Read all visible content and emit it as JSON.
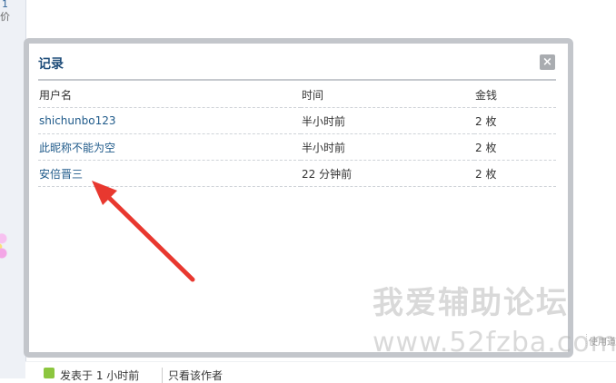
{
  "background": {
    "left_fragment_1": "1",
    "left_fragment_2": "价",
    "side_hint": "使用道",
    "post_info": "发表于 1 小时前",
    "author_only": "只看该作者"
  },
  "dialog": {
    "title": "记录",
    "close_symbol": "×",
    "columns": [
      "用户名",
      "时间",
      "金钱"
    ],
    "rows": [
      {
        "user": "shichunbo123",
        "time": "半小时前",
        "money": "2 枚"
      },
      {
        "user": "此昵称不能为空",
        "time": "半小时前",
        "money": "2 枚"
      },
      {
        "user": "安倍晋三",
        "time": "22 分钟前",
        "money": "2 枚"
      }
    ]
  },
  "watermark": {
    "line1": "我爱辅助论坛",
    "line2": "www.52fzba.com"
  },
  "colors": {
    "accent_link": "#1f5a8a",
    "title": "#1f4d7a",
    "arrow": "#e8382f"
  }
}
